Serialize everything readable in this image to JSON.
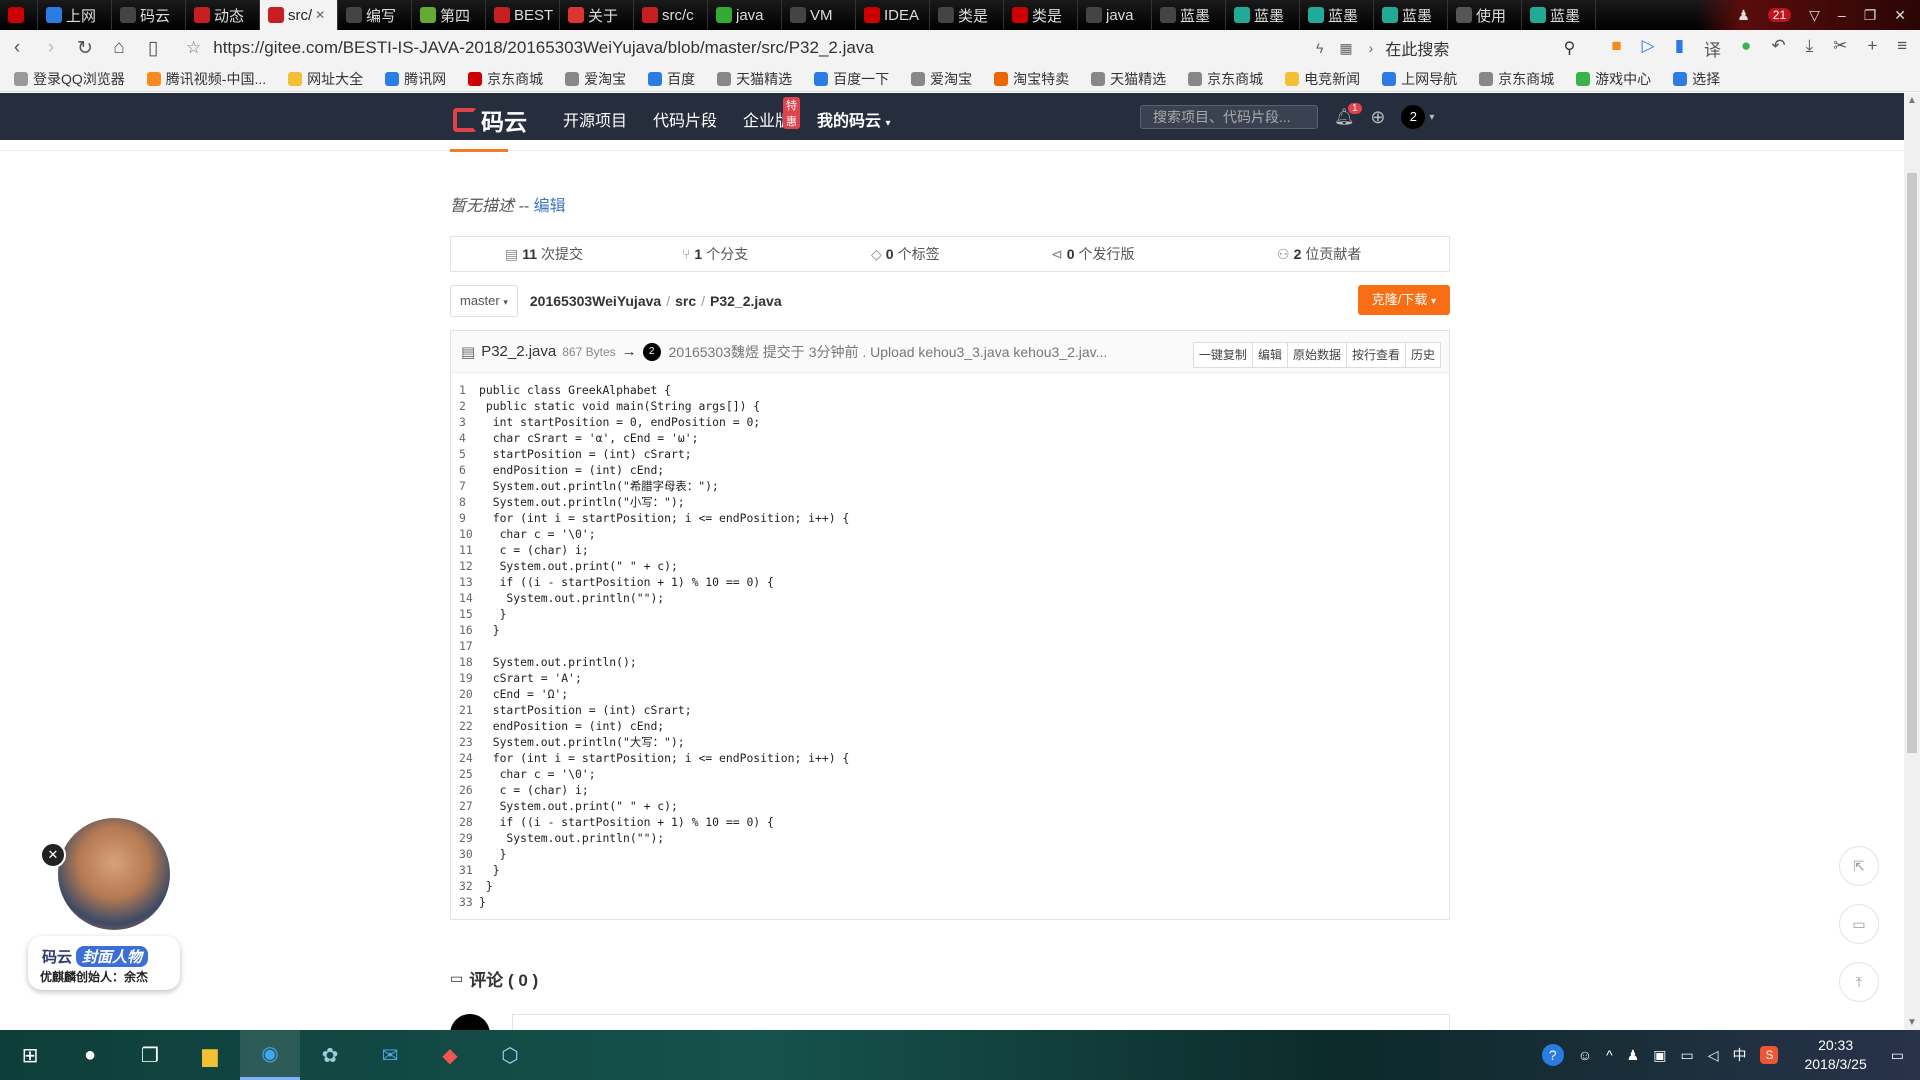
{
  "browser": {
    "tabs": [
      {
        "title": "",
        "icon": "ferrari-icon",
        "color": "#c00"
      },
      {
        "title": "上网",
        "icon": "qq-browser-icon",
        "color": "#2b7be4"
      },
      {
        "title": "码云",
        "icon": "sogou-icon",
        "color": "#444"
      },
      {
        "title": "动态",
        "icon": "gitee-icon",
        "color": "#c71d23"
      },
      {
        "title": "src/",
        "icon": "gitee-icon",
        "color": "#c71d23",
        "active": true
      },
      {
        "title": "编写",
        "icon": "sogou-icon",
        "color": "#444"
      },
      {
        "title": "第四",
        "icon": "image-icon",
        "color": "#6a3"
      },
      {
        "title": "BEST",
        "icon": "gitee-icon",
        "color": "#c71d23"
      },
      {
        "title": "关于",
        "icon": "colorful-icon",
        "color": "#d33"
      },
      {
        "title": "src/c",
        "icon": "gitee-icon",
        "color": "#c71d23"
      },
      {
        "title": "java",
        "icon": "leaf-icon",
        "color": "#3a3"
      },
      {
        "title": "VM",
        "icon": "sogou-icon",
        "color": "#444"
      },
      {
        "title": "IDEA",
        "icon": "csdn-icon",
        "color": "#c00"
      },
      {
        "title": "类是",
        "icon": "sogou-icon",
        "color": "#444"
      },
      {
        "title": "类是",
        "icon": "csdn-icon",
        "color": "#c00"
      },
      {
        "title": "java",
        "icon": "sogou-icon",
        "color": "#444"
      },
      {
        "title": "蓝墨",
        "icon": "sogou-icon",
        "color": "#444"
      },
      {
        "title": "蓝墨",
        "icon": "cloud-icon",
        "color": "#2a9"
      },
      {
        "title": "蓝墨",
        "icon": "cloud-icon",
        "color": "#2a9"
      },
      {
        "title": "蓝墨",
        "icon": "cloud-icon",
        "color": "#2a9"
      },
      {
        "title": "使用",
        "icon": "paw-icon",
        "color": "#555"
      },
      {
        "title": "蓝墨",
        "icon": "cloud-icon",
        "color": "#2a9"
      }
    ],
    "tab_counter": "21",
    "url": "https://gitee.com/BESTI-IS-JAVA-2018/20165303WeiYujava/blob/master/src/P32_2.java",
    "search_label": "在此搜索",
    "bookmarks": [
      "登录QQ浏览器",
      "腾讯视频-中国...",
      "网址大全",
      "腾讯网",
      "京东商城",
      "爱淘宝",
      "百度",
      "天猫精选",
      "百度一下",
      "爱淘宝",
      "淘宝特卖",
      "天猫精选",
      "京东商城",
      "电竞新闻",
      "上网导航",
      "京东商城",
      "游戏中心",
      "选择"
    ]
  },
  "site": {
    "logo_text": "码云",
    "nav": [
      "开源项目",
      "代码片段",
      "企业版",
      "我的码云"
    ],
    "hot_badge": "特惠",
    "search_placeholder": "搜索项目、代码片段...",
    "notification_count": "1",
    "user_avatar": "2"
  },
  "repo": {
    "description": "暂无描述",
    "description_sep": " -- ",
    "edit_link": "编辑",
    "stats": [
      {
        "count": "11",
        "label": " 次提交",
        "icon": "commit-icon"
      },
      {
        "count": "1",
        "label": " 个分支",
        "icon": "branch-icon"
      },
      {
        "count": "0",
        "label": " 个标签",
        "icon": "tag-icon"
      },
      {
        "count": "0",
        "label": " 个发行版",
        "icon": "release-icon"
      },
      {
        "count": "2",
        "label": " 位贡献者",
        "icon": "contributors-icon"
      }
    ],
    "branch": "master",
    "breadcrumb": [
      "20165303WeiYujava",
      "src",
      "P32_2.java"
    ],
    "clone_button": "克隆/下载"
  },
  "file": {
    "name": "P32_2.java",
    "size": "867 Bytes",
    "arrow": "→",
    "author_avatar": "2",
    "commit_msg": "20165303魏煜 提交于 3分钟前 . Upload kehou3_3.java kehou3_2.jav...",
    "actions": [
      "一键复制",
      "编辑",
      "原始数据",
      "按行查看",
      "历史"
    ],
    "lines": [
      "public class GreekAlphabet {",
      " public static void main(String args[]) {",
      "  int startPosition = 0, endPosition = 0;",
      "  char cSrart = 'α', cEnd = 'ω';",
      "  startPosition = (int) cSrart;",
      "  endPosition = (int) cEnd;",
      "  System.out.println(\"希腊字母表：\");",
      "  System.out.println(\"小写：\");",
      "  for (int i = startPosition; i <= endPosition; i++) {",
      "   char c = '\\0';",
      "   c = (char) i;",
      "   System.out.print(\" \" + c);",
      "   if ((i - startPosition + 1) % 10 == 0) {",
      "    System.out.println(\"\");",
      "   }",
      "  }",
      "",
      "  System.out.println();",
      "  cSrart = 'Α';",
      "  cEnd = 'Ω';",
      "  startPosition = (int) cSrart;",
      "  endPosition = (int) cEnd;",
      "  System.out.println(\"大写：\");",
      "  for (int i = startPosition; i <= endPosition; i++) {",
      "   char c = '\\0';",
      "   c = (char) i;",
      "   System.out.print(\" \" + c);",
      "   if ((i - startPosition + 1) % 10 == 0) {",
      "    System.out.println(\"\");",
      "   }",
      "  }",
      " }",
      "}"
    ]
  },
  "comments": {
    "title": "评论 ( 0 )"
  },
  "promo": {
    "brand": "码云",
    "badge": "封面人物",
    "subtitle": "优麒麟创始人：余杰"
  },
  "taskbar": {
    "time": "20:33",
    "date": "2018/3/25",
    "ime": "中"
  },
  "colors": {
    "accent": "#f96d14",
    "header": "#262e3d",
    "brand_red": "#e0434c"
  }
}
